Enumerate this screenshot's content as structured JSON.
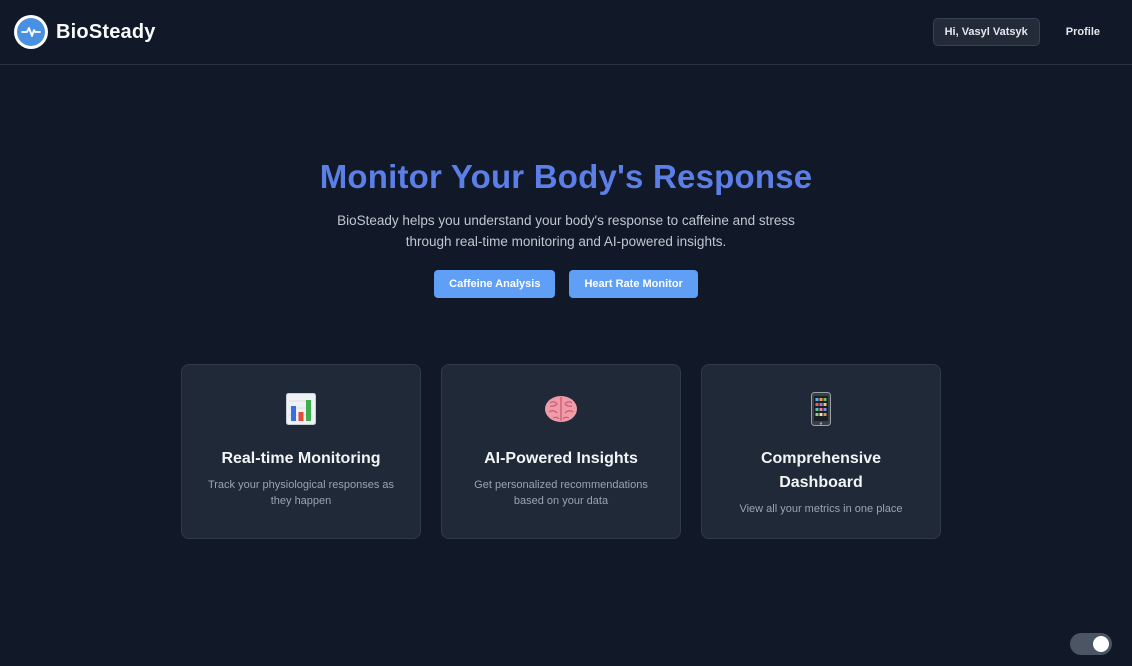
{
  "header": {
    "brand_name": "BioSteady",
    "greeting": "Hi, Vasyl Vatsyk",
    "profile_label": "Profile"
  },
  "hero": {
    "title": "Monitor Your Body's Response",
    "description": "BioSteady helps you understand your body's response to caffeine and stress through real-time monitoring and AI-powered insights.",
    "buttons": [
      {
        "label": "Caffeine Analysis"
      },
      {
        "label": "Heart Rate Monitor"
      }
    ]
  },
  "features": [
    {
      "icon": "bar-chart-icon",
      "title": "Real-time Monitoring",
      "description": "Track your physiological responses as they happen"
    },
    {
      "icon": "brain-icon",
      "title": "AI-Powered Insights",
      "description": "Get personalized recommendations based on your data"
    },
    {
      "icon": "mobile-phone-icon",
      "title": "Comprehensive Dashboard",
      "description": "View all your metrics in one place"
    }
  ],
  "theme_toggle": {
    "state": "on"
  },
  "colors": {
    "background": "#111827",
    "accent": "#5b7fe6",
    "button": "#5f9ff5",
    "card": "#1f2937"
  }
}
